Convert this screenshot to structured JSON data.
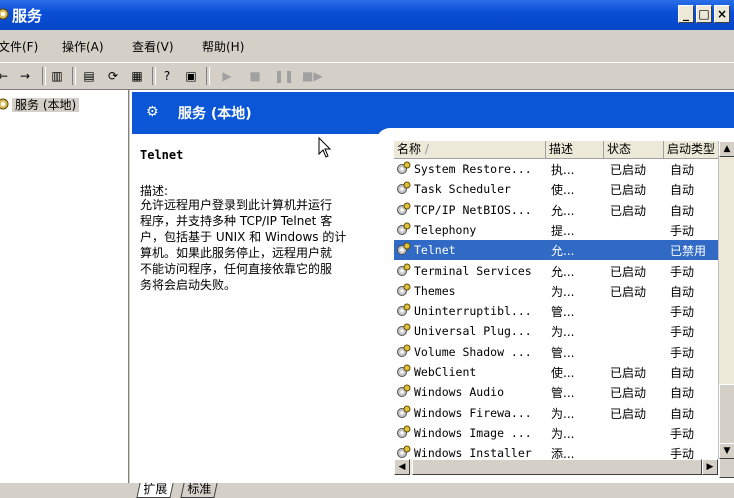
{
  "window": {
    "title": "服务"
  },
  "menu": {
    "items": [
      "文件(F)",
      "操作(A)",
      "查看(V)",
      "帮助(H)"
    ]
  },
  "tree": {
    "root_label": "服务 (本地)"
  },
  "banner": {
    "title": "服务 (本地)"
  },
  "detail": {
    "service_name": "Telnet",
    "description_label": "描述:",
    "description_lines": [
      "允许远程用户登录到此计算机并运行",
      "程序，并支持多种 TCP/IP Telnet 客",
      "户，包括基于 UNIX 和 Windows 的计",
      "算机。如果此服务停止，远程用户就",
      "不能访问程序，任何直接依靠它的服",
      "务将会启动失败。"
    ]
  },
  "columns": {
    "name": "名称",
    "desc": "描述",
    "status": "状态",
    "startup": "启动类型"
  },
  "services": [
    {
      "name": "System Restore...",
      "desc": "执...",
      "status": "已启动",
      "startup": "自动"
    },
    {
      "name": "Task Scheduler",
      "desc": "使...",
      "status": "已启动",
      "startup": "自动"
    },
    {
      "name": "TCP/IP NetBIOS...",
      "desc": "允...",
      "status": "已启动",
      "startup": "自动"
    },
    {
      "name": "Telephony",
      "desc": "提...",
      "status": "",
      "startup": "手动"
    },
    {
      "name": "Telnet",
      "desc": "允...",
      "status": "",
      "startup": "已禁用",
      "selected": true
    },
    {
      "name": "Terminal Services",
      "desc": "允...",
      "status": "已启动",
      "startup": "手动"
    },
    {
      "name": "Themes",
      "desc": "为...",
      "status": "已启动",
      "startup": "自动"
    },
    {
      "name": "Uninterruptibl...",
      "desc": "管...",
      "status": "",
      "startup": "手动"
    },
    {
      "name": "Universal Plug...",
      "desc": "为...",
      "status": "",
      "startup": "手动"
    },
    {
      "name": "Volume Shadow ...",
      "desc": "管...",
      "status": "",
      "startup": "手动"
    },
    {
      "name": "WebClient",
      "desc": "使...",
      "status": "已启动",
      "startup": "自动"
    },
    {
      "name": "Windows Audio",
      "desc": "管...",
      "status": "已启动",
      "startup": "自动"
    },
    {
      "name": "Windows Firewa...",
      "desc": "为...",
      "status": "已启动",
      "startup": "自动"
    },
    {
      "name": "Windows Image ...",
      "desc": "为...",
      "status": "",
      "startup": "手动"
    },
    {
      "name": "Windows Installer",
      "desc": "添...",
      "status": "",
      "startup": "手动"
    }
  ],
  "tabs": [
    "扩展",
    "标准"
  ],
  "colors": {
    "title_bar": "#0a4fd6",
    "banner": "#0a56d6",
    "selection": "#316ac5"
  }
}
